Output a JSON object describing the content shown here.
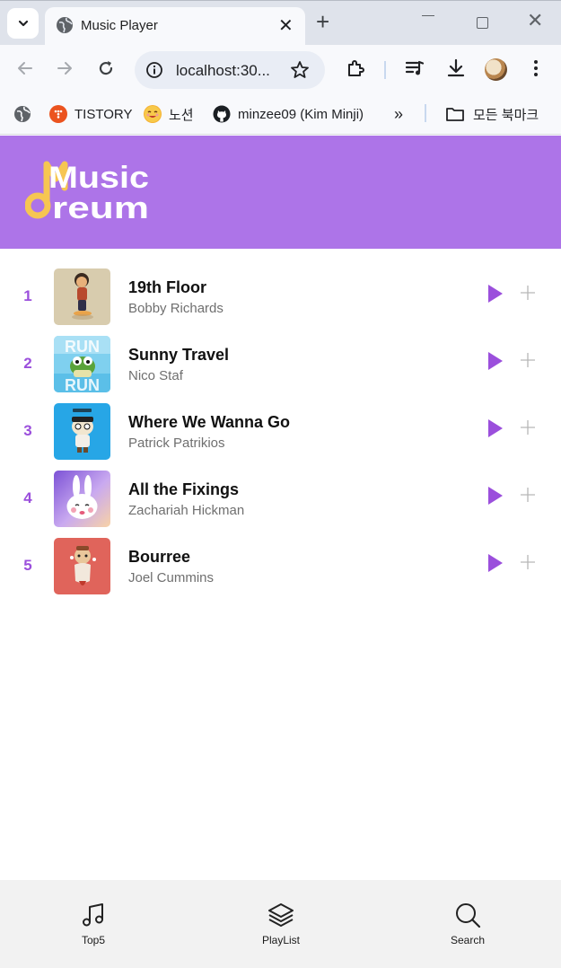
{
  "browser": {
    "tab_title": "Music Player",
    "new_tab_symbol": "+",
    "close_symbol": "✕",
    "url": "localhost:30...",
    "bookmarks": [
      {
        "label": "",
        "icon": "globe-icon"
      },
      {
        "label": "TISTORY",
        "icon": "tistory-icon"
      },
      {
        "label": "노션",
        "icon": "emoji-icon"
      },
      {
        "label": "minzee09 (Kim Minji)",
        "icon": "github-icon"
      }
    ],
    "bookmarks_overflow": "»",
    "all_bookmarks": "모든 북마크"
  },
  "app": {
    "logo_line1": "Music",
    "logo_line2": "reum",
    "accent_color": "#ad74e8",
    "rank_color": "#9b4fdc",
    "tracks": [
      {
        "rank": "1",
        "title": "19th Floor",
        "artist": "Bobby Richards"
      },
      {
        "rank": "2",
        "title": "Sunny Travel",
        "artist": "Nico Staf"
      },
      {
        "rank": "3",
        "title": "Where We Wanna Go",
        "artist": "Patrick Patrikios"
      },
      {
        "rank": "4",
        "title": "All the Fixings",
        "artist": "Zachariah Hickman"
      },
      {
        "rank": "5",
        "title": "Bourree",
        "artist": "Joel Cummins"
      }
    ],
    "nav": [
      {
        "label": "Top5",
        "icon": "music-note-icon"
      },
      {
        "label": "PlayList",
        "icon": "layers-icon"
      },
      {
        "label": "Search",
        "icon": "search-icon"
      }
    ]
  }
}
